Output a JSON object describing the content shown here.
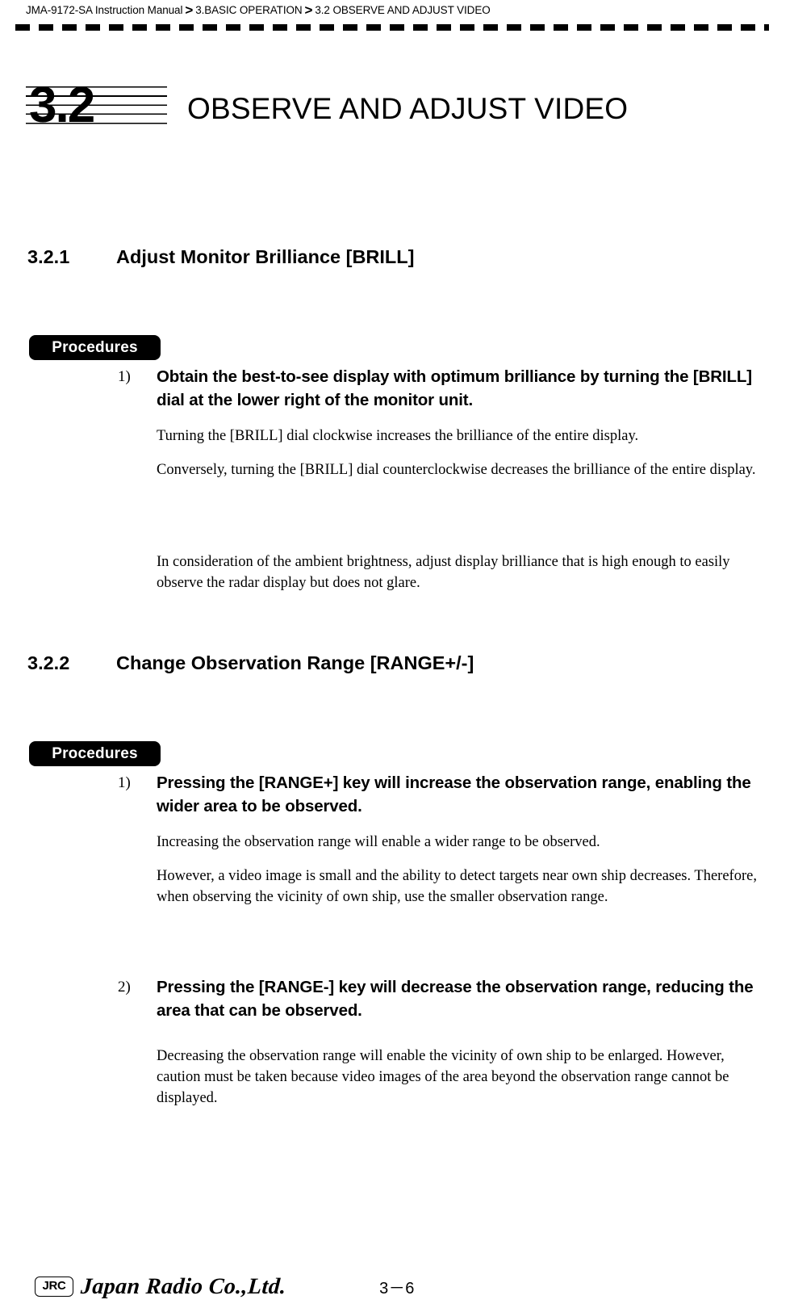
{
  "header": {
    "breadcrumb": {
      "manual": "JMA-9172-SA Instruction Manual",
      "separator": ">",
      "chapter": "3.BASIC OPERATION",
      "section": "3.2  OBSERVE AND ADJUST VIDEO"
    }
  },
  "chapter": {
    "number": "3.2",
    "title": "OBSERVE AND ADJUST VIDEO"
  },
  "sections": [
    {
      "number": "3.2.1",
      "title": "Adjust Monitor Brilliance [BRILL]",
      "procedures_label": "Procedures",
      "steps": [
        {
          "marker": "1)",
          "text": "Obtain the best-to-see display with optimum brilliance by turning the [BRILL] dial at the lower right of the monitor unit."
        }
      ],
      "paragraphs": [
        "Turning the [BRILL] dial clockwise increases the brilliance of the entire display.",
        "Conversely, turning the [BRILL] dial counterclockwise decreases the brilliance of the entire display.",
        "In consideration of the ambient brightness, adjust display brilliance that is high enough to easily observe the radar display but does not glare."
      ]
    },
    {
      "number": "3.2.2",
      "title": "Change Observation Range [RANGE+/-]",
      "procedures_label": "Procedures",
      "steps": [
        {
          "marker": "1)",
          "text": " Pressing the [RANGE+] key will increase the observation range, enabling the wider area to be observed."
        },
        {
          "marker": "2)",
          "text": " Pressing the [RANGE-] key will decrease the observation range, reducing the area that can be observed."
        }
      ],
      "paragraphs": [
        "Increasing the observation range will enable a wider range to be observed.",
        "However, a video image is small and the ability to detect targets near own ship decreases. Therefore, when observing the vicinity of own ship, use the smaller observation range.",
        "Decreasing the observation range will enable the vicinity of own ship to be enlarged. However, caution must be taken because video images of the area beyond the observation range cannot be displayed."
      ]
    }
  ],
  "footer": {
    "logo_mark": "JRC",
    "company": "Japan Radio Co.,Ltd.",
    "page_number": "3－6"
  }
}
